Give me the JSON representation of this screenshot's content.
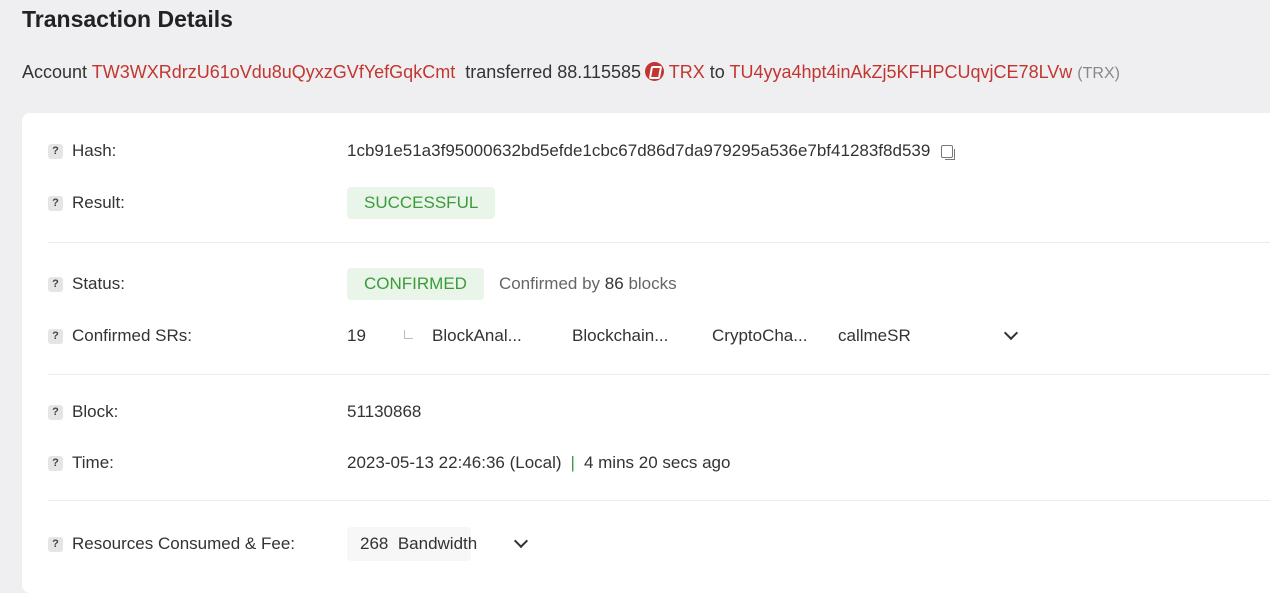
{
  "page": {
    "title": "Transaction Details"
  },
  "summary": {
    "account_label": "Account",
    "from_address": "TW3WXRdrzU61oVdu8uQyxzGVfYefGqkCmt",
    "transferred_label": "transferred",
    "amount": "88.115585",
    "token": "TRX",
    "to_label": "to",
    "to_address": "TU4yya4hpt4inAkZj5KFHPCUqvjCE78LVw",
    "to_token_tag": "(TRX)"
  },
  "fields": {
    "hash": {
      "label": "Hash:",
      "value": "1cb91e51a3f95000632bd5efde1cbc67d86d7da979295a536e7bf41283f8d539"
    },
    "result": {
      "label": "Result:",
      "value": "SUCCESSFUL"
    },
    "status": {
      "label": "Status:",
      "value": "CONFIRMED",
      "confirmed_prefix": "Confirmed by",
      "confirmed_blocks": "86",
      "confirmed_suffix": "blocks"
    },
    "confirmed_srs": {
      "label": "Confirmed SRs:",
      "count": "19",
      "srs": [
        "BlockAnal...",
        "Blockchain...",
        "CryptoCha...",
        "callmeSR"
      ]
    },
    "block": {
      "label": "Block:",
      "value": "51130868"
    },
    "time": {
      "label": "Time:",
      "value": "2023-05-13 22:46:36 (Local)",
      "separator": "|",
      "ago": "4 mins 20 secs ago"
    },
    "resources": {
      "label": "Resources Consumed & Fee:",
      "amount": "268",
      "unit": "Bandwidth"
    }
  },
  "help_glyph": "?",
  "colors": {
    "accent_red": "#c23631",
    "success_green": "#3c9a3c",
    "badge_bg": "#e8f5e8"
  }
}
